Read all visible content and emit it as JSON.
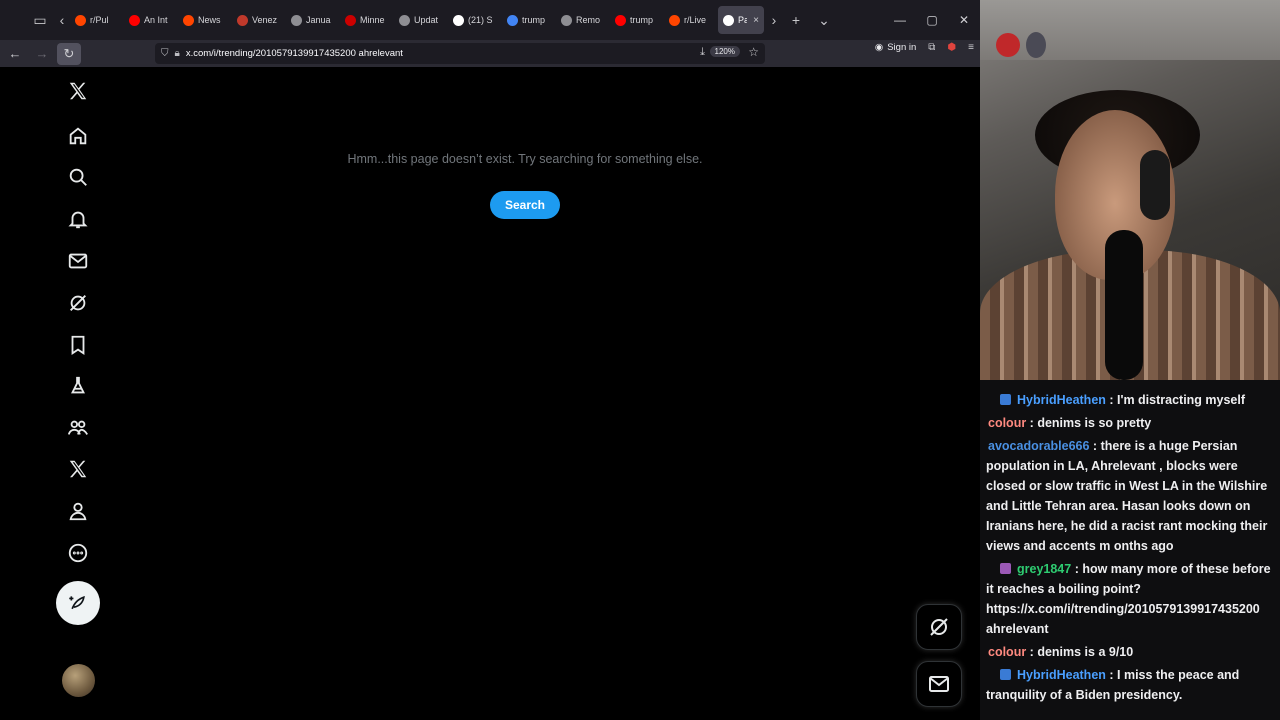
{
  "browser": {
    "tabs": [
      {
        "label": "r/Pul",
        "color": "#ff4500"
      },
      {
        "label": "An Int",
        "color": "#ff0000"
      },
      {
        "label": "News",
        "color": "#ff4500"
      },
      {
        "label": "Venez",
        "color": "#c0392b"
      },
      {
        "label": "Janua",
        "color": "#8e8e93"
      },
      {
        "label": "Minne",
        "color": "#cc0000"
      },
      {
        "label": "Updat",
        "color": "#8e8e93"
      },
      {
        "label": "(21) S",
        "color": "#ffffff"
      },
      {
        "label": "trump",
        "color": "#4285f4"
      },
      {
        "label": "Remo",
        "color": "#8e8e93"
      },
      {
        "label": "trump",
        "color": "#ff0000"
      },
      {
        "label": "r/Live",
        "color": "#ff4500"
      },
      {
        "label": "Pag",
        "color": "#ffffff"
      }
    ],
    "url": "x.com/i/trending/2010579139917435200 ahrelevant",
    "zoom": "120%",
    "signin": "Sign in"
  },
  "xpage": {
    "error_message": "Hmm...this page doesn’t exist. Try searching for something else.",
    "search_label": "Search"
  },
  "chat": [
    {
      "user": "HybridHeathen",
      "color": "#4a9fff",
      "badge": "#3a7bd5",
      "message": "I'm distracting myself"
    },
    {
      "user": "colour",
      "color": "#ff8a80",
      "badge": null,
      "message": "denims is so pretty"
    },
    {
      "user": "avocadorable666",
      "color": "#4a90e2",
      "badge": null,
      "message": "there is a huge Persian population in LA, Ahrelevant , blocks were closed or slow traffic in West LA in the Wilshire and Little Tehran area. Hasan looks down on Iranians here, he did a racist rant mocking their views and accents m onths ago"
    },
    {
      "user": "grey1847",
      "color": "#2ecc71",
      "badge": "#9b59b6",
      "message": "how many more of these before it reaches a boiling point? https://x.com/i/trending/2010579139917435200 ahrelevant"
    },
    {
      "user": "colour",
      "color": "#ff8a80",
      "badge": null,
      "message": "denims is a 9/10"
    },
    {
      "user": "HybridHeathen",
      "color": "#4a9fff",
      "badge": "#3a7bd5",
      "message": "I miss the peace and tranquility of a Biden presidency."
    }
  ]
}
